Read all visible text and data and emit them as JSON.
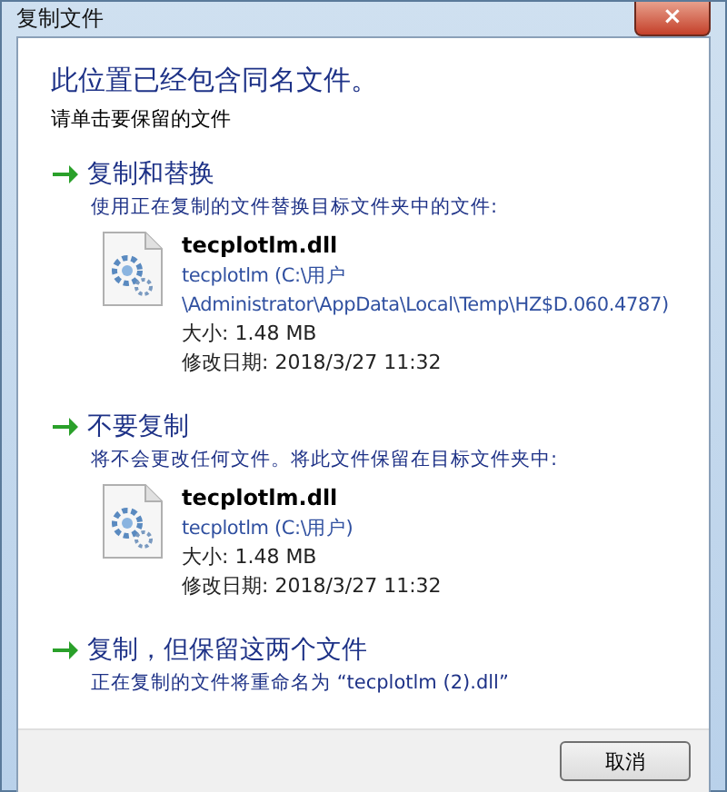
{
  "window": {
    "title": "复制文件",
    "close": "×"
  },
  "heading": "此位置已经包含同名文件。",
  "instruction": "请单击要保留的文件",
  "options": [
    {
      "title": "复制和替换",
      "description": "使用正在复制的文件替换目标文件夹中的文件:",
      "file": {
        "name": "tecplotlm.dll",
        "location_lines": [
          "tecplotlm (C:\\用户",
          "\\Administrator\\AppData\\Local\\Temp\\HZ$D.060.4787)"
        ],
        "size": "大小: 1.48 MB",
        "modified": "修改日期: 2018/3/27 11:32"
      }
    },
    {
      "title": "不要复制",
      "description": "将不会更改任何文件。将此文件保留在目标文件夹中:",
      "file": {
        "name": "tecplotlm.dll",
        "location_lines": [
          "tecplotlm (C:\\用户)"
        ],
        "size": "大小: 1.48 MB",
        "modified": "修改日期: 2018/3/27 11:32"
      }
    },
    {
      "title": "复制，但保留这两个文件",
      "description": "正在复制的文件将重命名为 “tecplotlm (2).dll”"
    }
  ],
  "buttons": [
    "取消"
  ]
}
